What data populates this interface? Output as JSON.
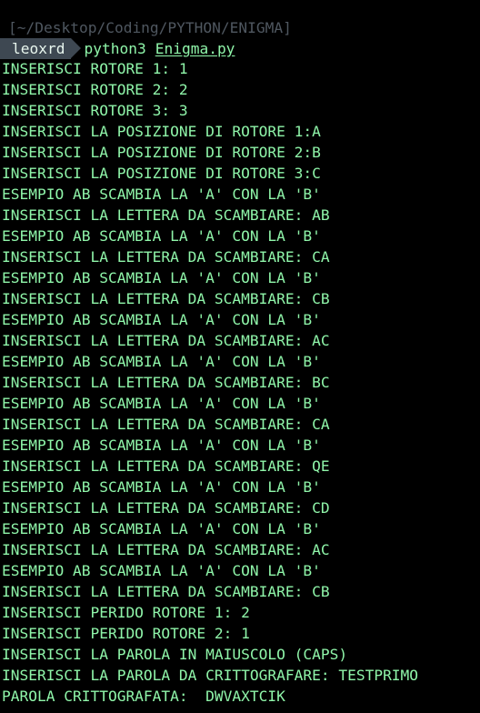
{
  "terminal": {
    "path": "[~/Desktop/Coding/PYTHON/ENIGMA]",
    "prompt": {
      "user": "leoxrd",
      "command": "python3",
      "file": "Enigma.py"
    },
    "output": [
      "INSERISCI ROTORE 1: 1",
      "INSERISCI ROTORE 2: 2",
      "INSERISCI ROTORE 3: 3",
      "INSERISCI LA POSIZIONE DI ROTORE 1:A",
      "INSERISCI LA POSIZIONE DI ROTORE 2:B",
      "INSERISCI LA POSIZIONE DI ROTORE 3:C",
      "ESEMPIO AB SCAMBIA LA 'A' CON LA 'B'",
      "INSERISCI LA LETTERA DA SCAMBIARE: AB",
      "ESEMPIO AB SCAMBIA LA 'A' CON LA 'B'",
      "INSERISCI LA LETTERA DA SCAMBIARE: CA",
      "ESEMPIO AB SCAMBIA LA 'A' CON LA 'B'",
      "INSERISCI LA LETTERA DA SCAMBIARE: CB",
      "ESEMPIO AB SCAMBIA LA 'A' CON LA 'B'",
      "INSERISCI LA LETTERA DA SCAMBIARE: AC",
      "ESEMPIO AB SCAMBIA LA 'A' CON LA 'B'",
      "INSERISCI LA LETTERA DA SCAMBIARE: BC",
      "ESEMPIO AB SCAMBIA LA 'A' CON LA 'B'",
      "INSERISCI LA LETTERA DA SCAMBIARE: CA",
      "ESEMPIO AB SCAMBIA LA 'A' CON LA 'B'",
      "INSERISCI LA LETTERA DA SCAMBIARE: QE",
      "ESEMPIO AB SCAMBIA LA 'A' CON LA 'B'",
      "INSERISCI LA LETTERA DA SCAMBIARE: CD",
      "ESEMPIO AB SCAMBIA LA 'A' CON LA 'B'",
      "INSERISCI LA LETTERA DA SCAMBIARE: AC",
      "ESEMPIO AB SCAMBIA LA 'A' CON LA 'B'",
      "INSERISCI LA LETTERA DA SCAMBIARE: CB",
      "INSERISCI PERIDO ROTORE 1: 2",
      "INSERISCI PERIDO ROTORE 2: 1",
      "INSERISCI LA PAROLA IN MAIUSCOLO (CAPS)",
      "INSERISCI LA PAROLA DA CRITTOGRAFARE: TESTPRIMO",
      "PAROLA CRITTOGRAFATA:  DWVAXTCIK"
    ]
  },
  "colors": {
    "background": "#000000",
    "text": "#8ff5a9",
    "path": "#4f5760",
    "prompt_bg": "#3e4852",
    "prompt_user_text": "#e8f6ee"
  }
}
